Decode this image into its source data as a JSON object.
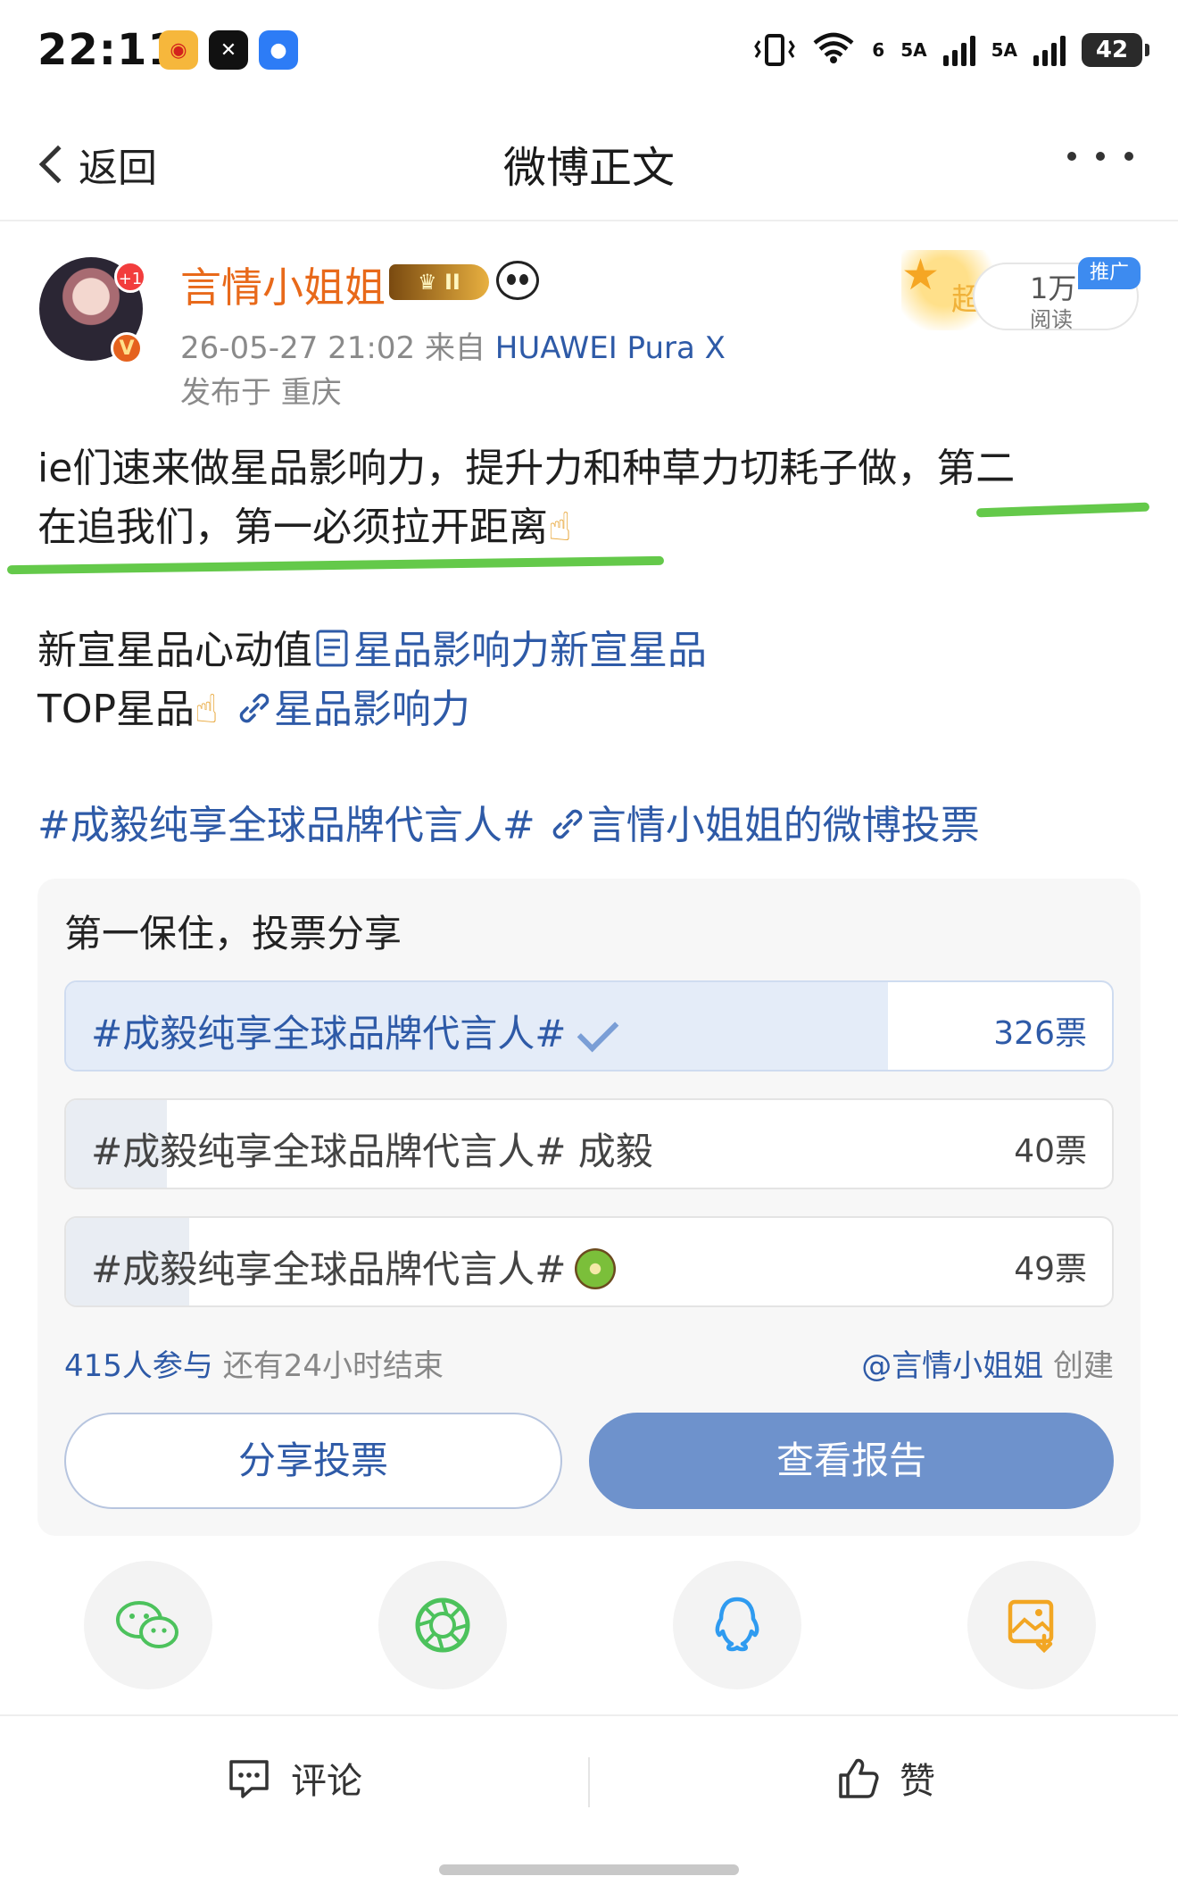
{
  "status_bar": {
    "time": "22:11",
    "app_icons": [
      "weibo-icon",
      "capcut-icon",
      "chat-icon"
    ],
    "signal_1": "6",
    "signal_2": "5A",
    "signal_3": "5A",
    "battery": "42"
  },
  "nav": {
    "back_label": "返回",
    "title": "微博正文"
  },
  "author": {
    "avatar_badge": "+1",
    "verified": "V",
    "name": "言情小姐姐",
    "level_badge": "II",
    "timestamp": "26-05-27 21:02",
    "from_label": "来自",
    "device": "HUAWEI Pura X",
    "location": "发布于 重庆",
    "promo_char": "超",
    "reads": "1万",
    "reads_label": "阅读",
    "ad_tag": "推广"
  },
  "post": {
    "text_main": "ie们速来做星品影响力，提升力和种草力切耗子做，",
    "text_underlined_a": "第二",
    "text_underlined_b": "在追我们，第一必须拉开距离",
    "emoji_1": "☝",
    "line2_text": "新宣星品心动值",
    "line2_link": "星品影响力新宣星品",
    "line3_text": "TOP星品",
    "emoji_2": "☝",
    "line3_link": "星品影响力",
    "topic": "#成毅纯享全球品牌代言人#",
    "vote_link": "言情小姐姐的微博投票"
  },
  "poll": {
    "title": "第一保住，投票分享",
    "options": [
      {
        "label": "#成毅纯享全球品牌代言人#",
        "votes": "326票",
        "share": 0.786,
        "selected": true
      },
      {
        "label": "#成毅纯享全球品牌代言人# 成毅",
        "votes": "40票",
        "share": 0.096,
        "selected": false
      },
      {
        "label": "#成毅纯享全球品牌代言人#",
        "votes": "49票",
        "share": 0.118,
        "selected": false
      }
    ],
    "participants": "415人参与",
    "time_left": "还有24小时结束",
    "creator": "@言情小姐姐",
    "created_label": "创建",
    "share_button": "分享投票",
    "report_button": "查看报告"
  },
  "share_targets": [
    "wechat-icon",
    "moments-icon",
    "qq-icon",
    "save-image-icon"
  ],
  "bottom_bar": {
    "comment_label": "评论",
    "like_label": "赞"
  },
  "colors": {
    "link": "#2e5aa7",
    "username": "#e8691a",
    "highlight": "#64c94a",
    "report_button": "#6e92cc"
  }
}
